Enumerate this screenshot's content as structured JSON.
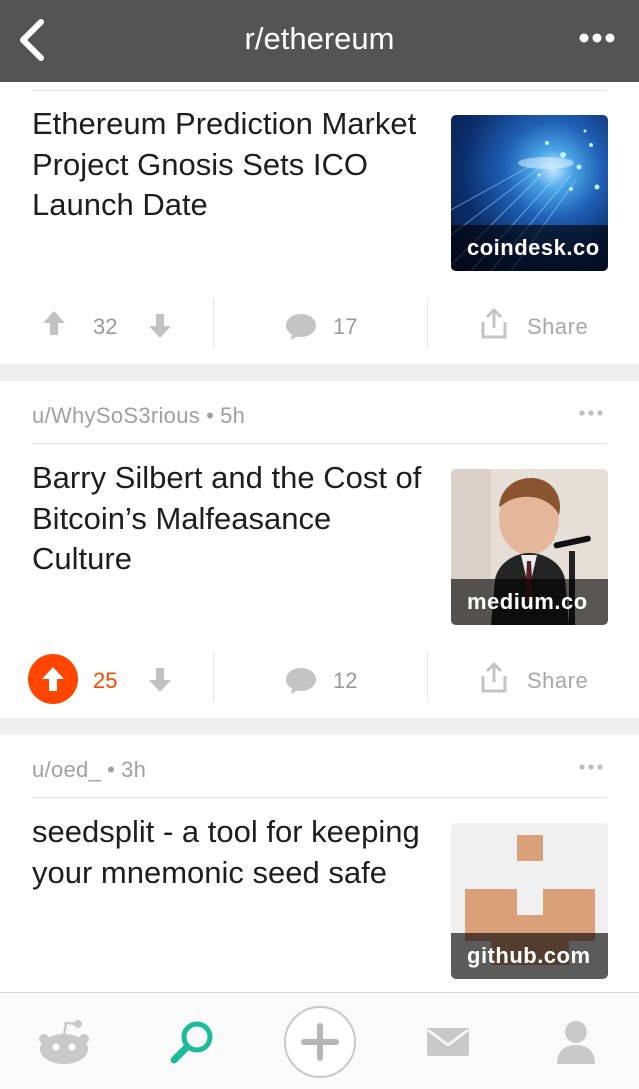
{
  "header": {
    "title": "r/ethereum",
    "back_icon": "chevron-left-icon",
    "more_icon": "more-horizontal-icon"
  },
  "posts": [
    {
      "title": "Ethereum Prediction Market Project Gnosis Sets ICO Launch Date",
      "thumb_domain": "coindesk.co",
      "score": "32",
      "comments": "17",
      "share_label": "Share",
      "upvoted": false
    },
    {
      "author": "u/WhySoS3rious",
      "age": "5h",
      "title": "Barry Silbert and the Cost of Bitcoin’s Malfeasance Culture",
      "thumb_domain": "medium.co",
      "score": "25",
      "comments": "12",
      "share_label": "Share",
      "upvoted": true
    },
    {
      "author": "u/oed_",
      "age": "3h",
      "title": "seedsplit - a tool for keeping your mnemonic seed safe",
      "thumb_domain": "github.com"
    }
  ],
  "separator": "•",
  "tabbar": {
    "items": [
      "home-icon",
      "search-icon",
      "post-icon",
      "inbox-icon",
      "profile-icon"
    ],
    "active": "search-icon"
  },
  "colors": {
    "header_bg": "#545454",
    "upvote_active": "#ff4500",
    "search_active": "#1abc9c",
    "muted": "#9a9a9a"
  }
}
